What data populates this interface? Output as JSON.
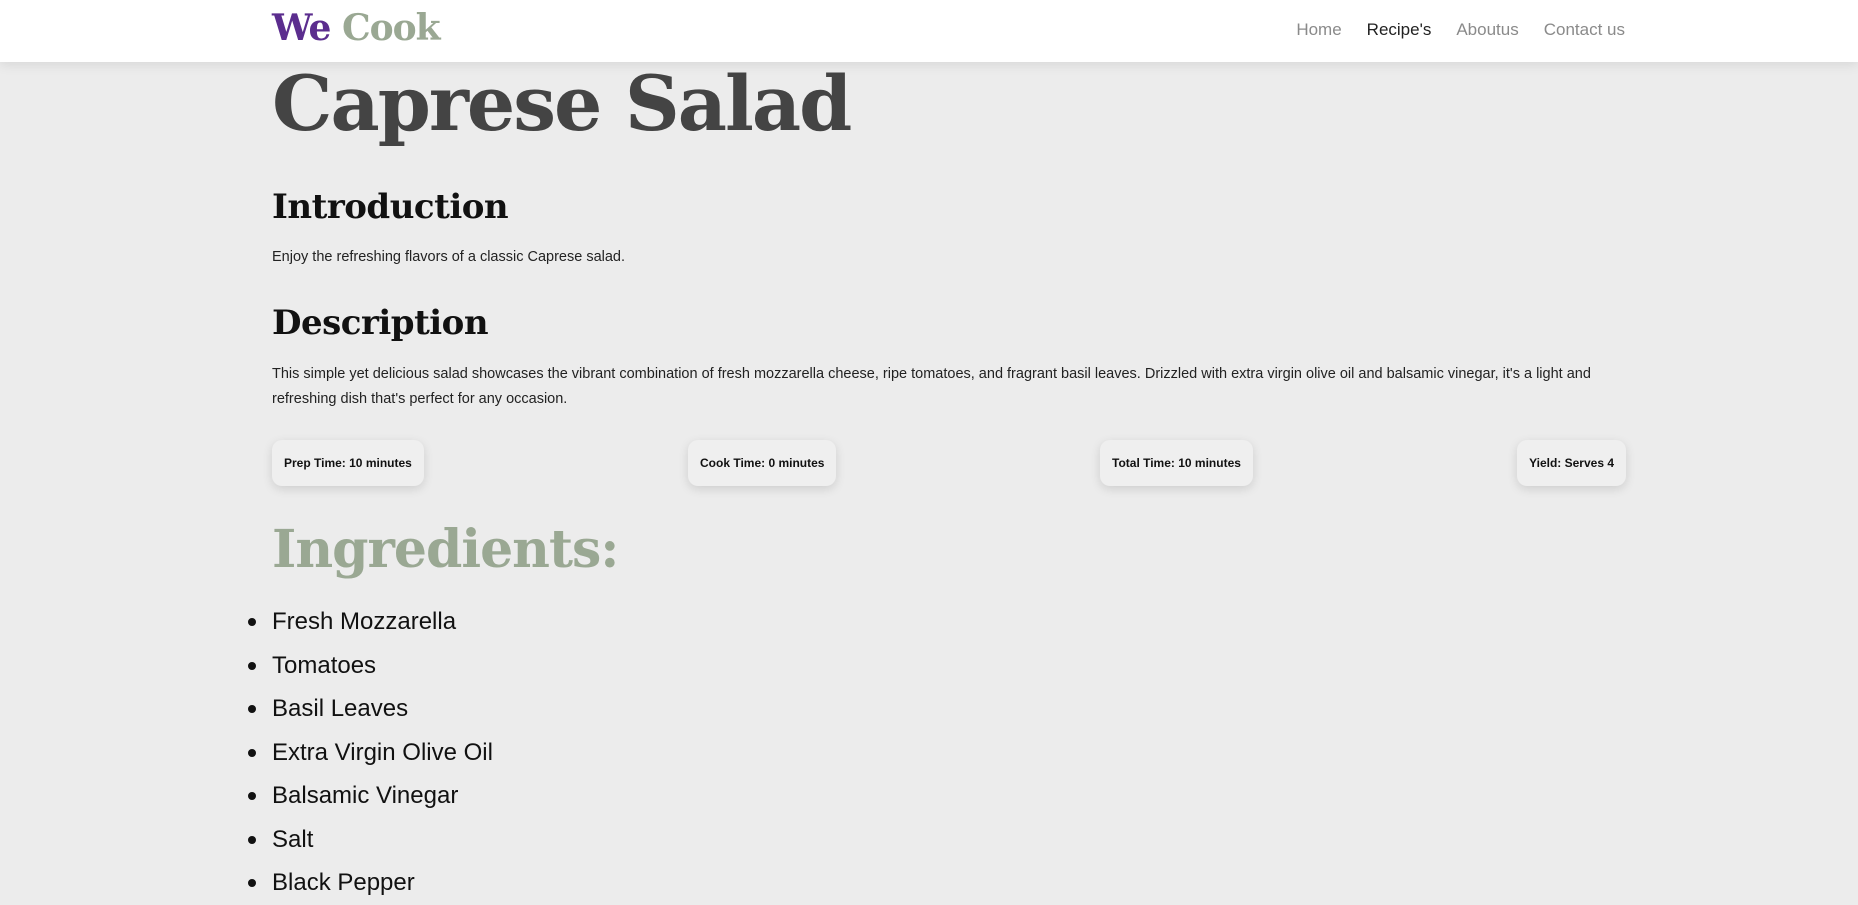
{
  "brand": {
    "first": "We",
    "second": "Cook"
  },
  "nav": {
    "items": [
      {
        "label": "Home",
        "active": false
      },
      {
        "label": "Recipe's",
        "active": true
      },
      {
        "label": "Aboutus",
        "active": false
      },
      {
        "label": "Contact us",
        "active": false
      }
    ]
  },
  "recipe": {
    "title": "Caprese Salad",
    "introduction": {
      "heading": "Introduction",
      "text": "Enjoy the refreshing flavors of a classic Caprese salad."
    },
    "description": {
      "heading": "Description",
      "text": "This simple yet delicious salad showcases the vibrant combination of fresh mozzarella cheese, ripe tomatoes, and fragrant basil leaves. Drizzled with extra virgin olive oil and balsamic vinegar, it's a light and refreshing dish that's perfect for any occasion."
    },
    "stats": {
      "prep": "Prep Time: 10 minutes",
      "cook": "Cook Time: 0 minutes",
      "total": "Total Time: 10 minutes",
      "yield": "Yield: Serves 4"
    },
    "ingredients": {
      "heading": "Ingredients:",
      "items": [
        "Fresh Mozzarella",
        "Tomatoes",
        "Basil Leaves",
        "Extra Virgin Olive Oil",
        "Balsamic Vinegar",
        "Salt",
        "Black Pepper"
      ]
    }
  },
  "colors": {
    "brand_we": "#5b2d8e",
    "brand_cook": "#9aa893",
    "title": "#444444",
    "ingredients_heading": "#9aa893",
    "background": "#ececec"
  }
}
